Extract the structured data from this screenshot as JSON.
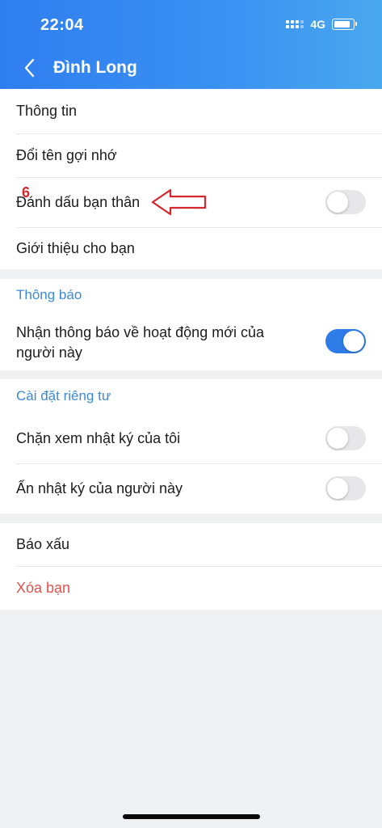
{
  "status": {
    "time": "22:04",
    "network": "4G"
  },
  "header": {
    "title": "Đình Long"
  },
  "general": {
    "items": [
      {
        "label": "Thông tin"
      },
      {
        "label": "Đổi tên gợi nhớ"
      },
      {
        "label": "Đánh dấu bạn thân",
        "toggle": false
      },
      {
        "label": "Giới thiệu cho bạn"
      }
    ]
  },
  "annotation": {
    "number": "6"
  },
  "notifications": {
    "title": "Thông báo",
    "item_line1": "Nhận thông báo về hoạt động mới của",
    "item_line2": "người này",
    "toggle": true
  },
  "privacy": {
    "title": "Cài đặt riêng tư",
    "items": [
      {
        "label": "Chặn xem nhật ký của tôi",
        "toggle": false
      },
      {
        "label": "Ẩn nhật ký của người này",
        "toggle": false
      }
    ]
  },
  "actions": {
    "report": "Báo xấu",
    "remove": "Xóa bạn"
  },
  "colors": {
    "accent": "#2e7ce8",
    "section_title": "#3a8ad8",
    "danger": "#e1524d",
    "annotation": "#d8262d"
  }
}
